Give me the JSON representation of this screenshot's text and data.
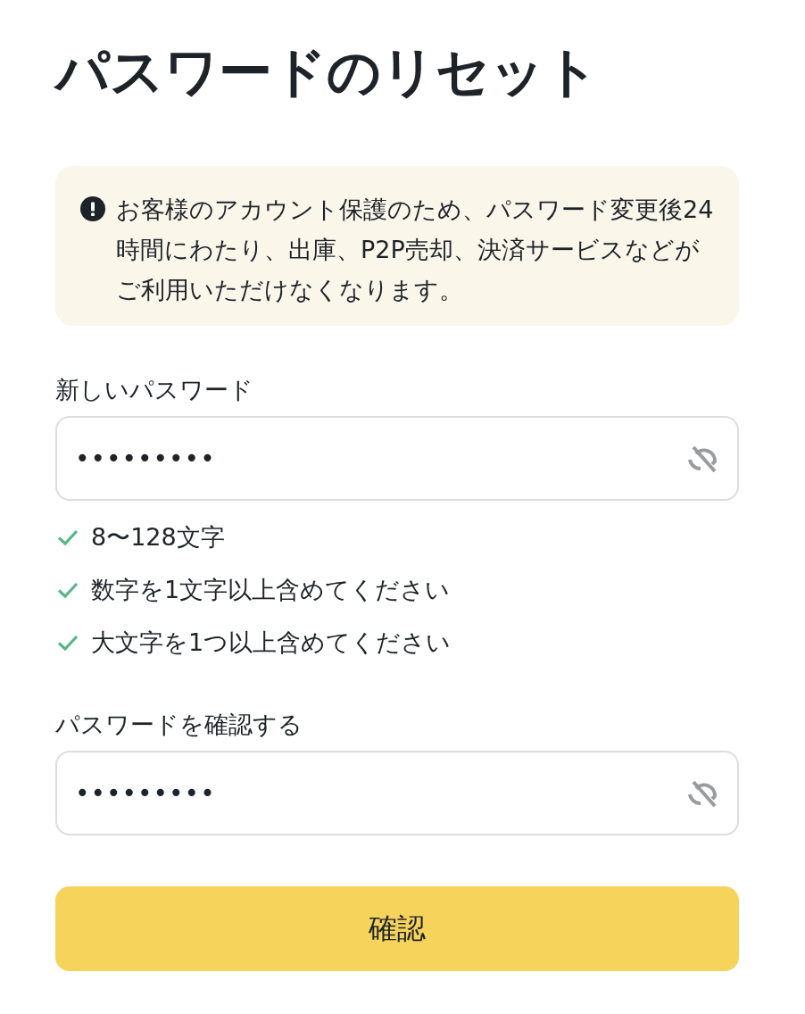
{
  "title": "パスワードのリセット",
  "notice": {
    "text": "お客様のアカウント保護のため、パスワード変更後24時間にわたり、出庫、P2P売却、決済サービスなどがご利用いただけなくなります。"
  },
  "fields": [
    {
      "label": "新しいパスワード",
      "value": "•••••••••",
      "revealed": false,
      "requirements": [
        {
          "text": "8〜128文字",
          "met": true
        },
        {
          "text": "数字を1文字以上含めてください",
          "met": true
        },
        {
          "text": "大文字を1つ以上含めてください",
          "met": true
        }
      ]
    },
    {
      "label": "パスワードを確認する",
      "value": "•••••••••",
      "revealed": false
    }
  ],
  "submit_button": {
    "label": "確認"
  }
}
